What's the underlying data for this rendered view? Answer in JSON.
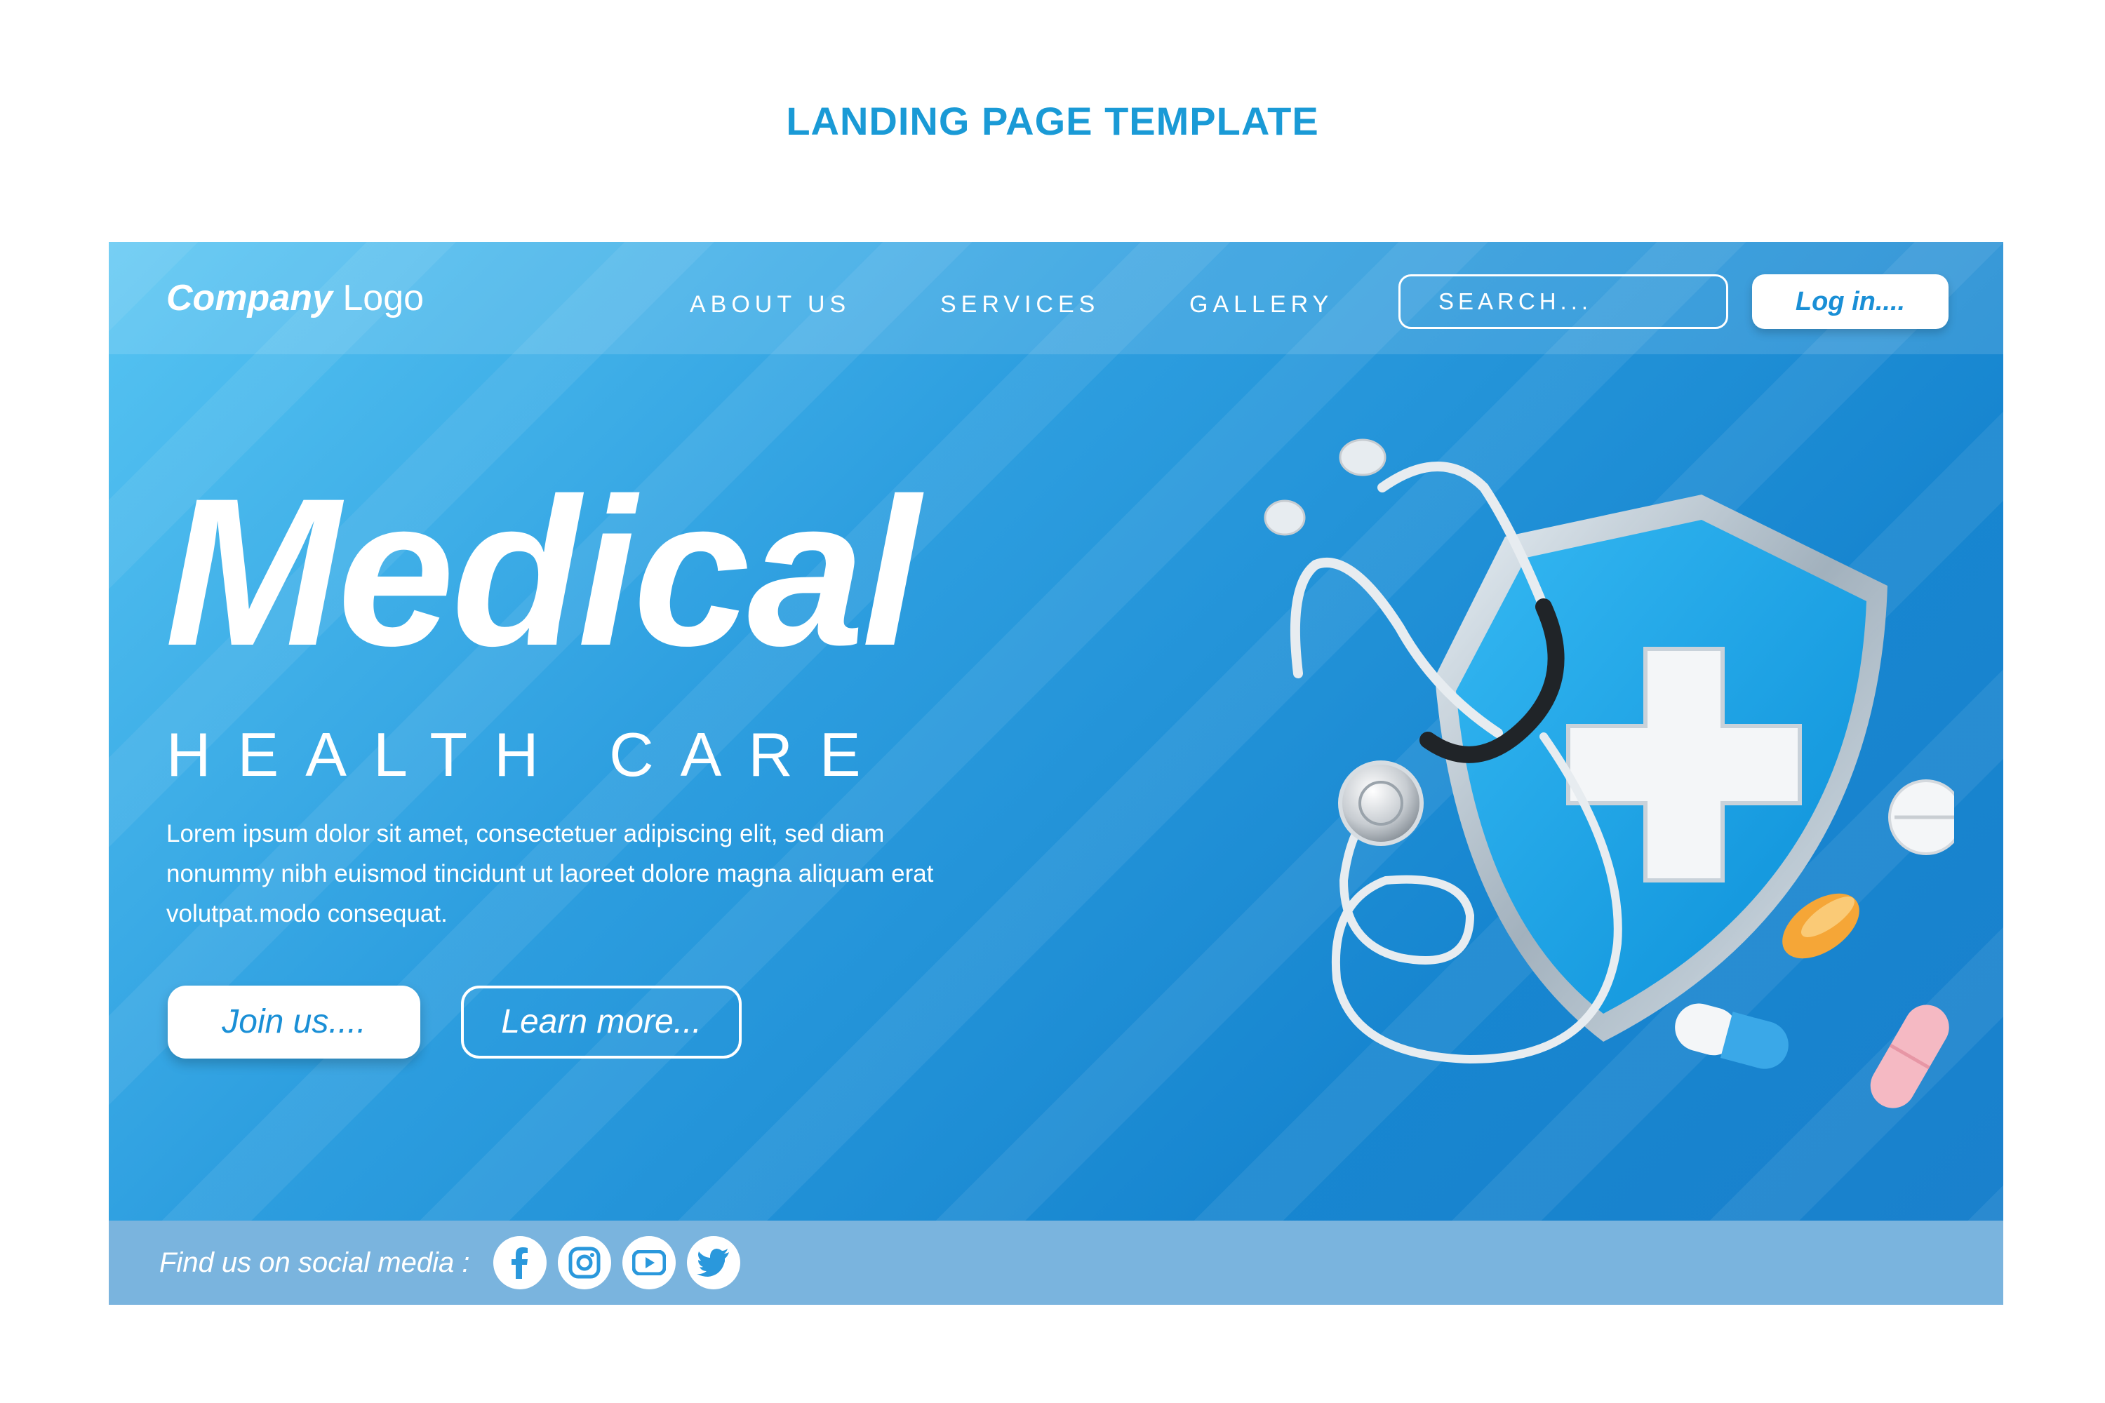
{
  "page_heading": "LANDING PAGE TEMPLATE",
  "header": {
    "logo_bold": "Company",
    "logo_light": " Logo",
    "nav": {
      "about": "ABOUT US",
      "services": "SERVICES",
      "gallery": "GALLERY"
    },
    "search_placeholder": "SEARCH...",
    "login_label": "Log in...."
  },
  "hero": {
    "title": "Medical",
    "subtitle": "HEALTH CARE",
    "body": "Lorem ipsum dolor sit amet, consectetuer adipiscing elit, sed diam nonummy nibh euismod tincidunt ut laoreet dolore magna aliquam erat volutpat.modo consequat.",
    "join_label": "Join us....",
    "learn_label": "Learn more..."
  },
  "footer": {
    "social_label": "Find us on social media :",
    "social_icons": [
      "facebook-icon",
      "instagram-icon",
      "youtube-icon",
      "twitter-icon"
    ]
  },
  "colors": {
    "accent": "#1a9ad6",
    "banner_light": "#56c4f2",
    "banner_dark": "#1a80cc",
    "footer_bar": "#7ab4de"
  }
}
